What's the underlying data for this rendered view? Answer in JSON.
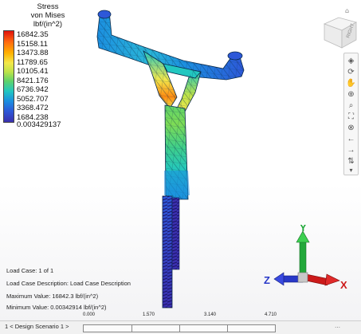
{
  "legend": {
    "title_lines": [
      "Stress",
      "von Mises",
      "lbf/(in^2)"
    ],
    "values": [
      "16842.35",
      "15158.11",
      "13473.88",
      "11789.65",
      "10105.41",
      "8421.176",
      "6736.942",
      "5052.707",
      "3368.472",
      "1684.238",
      "0.003429137"
    ]
  },
  "info": {
    "load_case": "Load Case:   1 of 1",
    "load_case_description": "Load Case Description:  Load Case Description",
    "max_value": "Maximum Value: 16842.3 lbf/(in^2)",
    "min_value": "Minimum Value: 0.00342914 lbf/(in^2)"
  },
  "scenario": {
    "label": "1 < Design Scenario 1 >",
    "ticks": [
      "0.000",
      "1.570",
      "3.140",
      "4.710"
    ]
  },
  "viewcube": {
    "face_label": "RIGHT"
  },
  "triad": {
    "x": "X",
    "y": "Y",
    "z": "Z"
  },
  "toolbar": {
    "icons": [
      "cube-icon",
      "orbit-icon",
      "pan-icon",
      "zoom-icon",
      "zoom-window-icon",
      "fit-icon",
      "look-at-icon",
      "prev-view-icon",
      "next-view-icon",
      "walk-icon",
      "settings-icon"
    ]
  },
  "colors": {
    "hot": "#e1120c",
    "mid": "#5fd36a",
    "cool": "#1b8fe0",
    "low": "#3a2fae"
  }
}
